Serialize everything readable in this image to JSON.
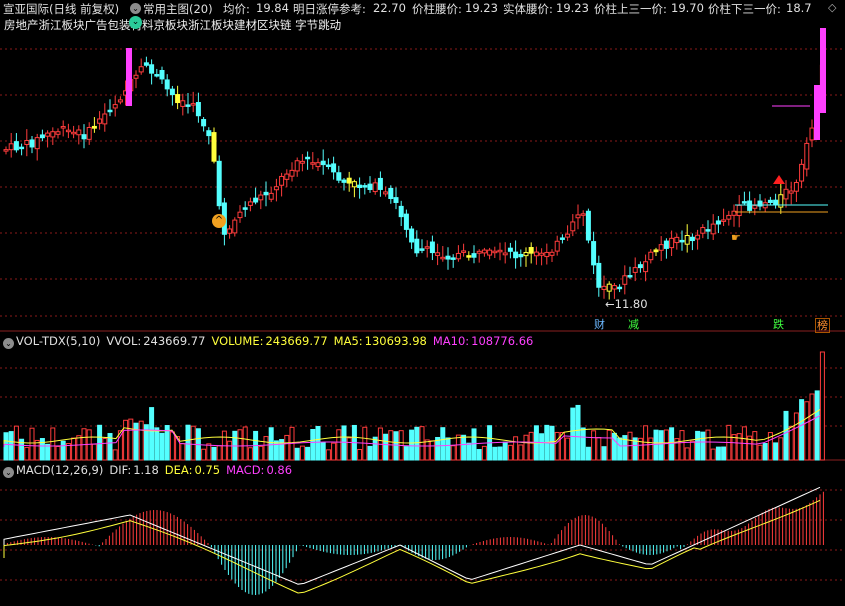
{
  "header": {
    "stock_name": "宣亚国际(日线 前复权)",
    "formula_menu": "常用主图(20)",
    "avg_label": "均价:",
    "avg_value": "19.84",
    "limit_label": "明日涨停参考:",
    "limit_value": "22.70",
    "waist_label": "价柱腰价:",
    "waist_value": "19.23",
    "body_waist_label": "实体腰价:",
    "body_waist_value": "19.23",
    "upper_third_label": "价柱上三一价:",
    "upper_third_value": "19.70",
    "lower_third_label": "价柱下三一价:",
    "lower_third_value": "18.7"
  },
  "sector_tags": "房地产浙江板块广告包装材料京板块浙江板块建材区块链 字节跳动",
  "price_panel": {
    "low_label": "11.80",
    "event_badges": [
      "财",
      "减",
      "跌",
      "榜"
    ]
  },
  "volume_panel": {
    "indicator": "VOL-TDX(5,10)",
    "vvol_label": "VVOL:",
    "vvol_value": "243669.77",
    "volume_label": "VOLUME:",
    "volume_value": "243669.77",
    "ma5_label": "MA5:",
    "ma5_value": "130693.98",
    "ma10_label": "MA10:",
    "ma10_value": "108776.66"
  },
  "macd_panel": {
    "indicator": "MACD(12,26,9)",
    "dif_label": "DIF:",
    "dif_value": "1.18",
    "dea_label": "DEA:",
    "dea_value": "0.75",
    "macd_label": "MACD:",
    "macd_value": "0.86"
  },
  "colors": {
    "up": "#ff3c3c",
    "down": "#54ffff",
    "yellow": "#ffff3c",
    "magenta": "#ff40ff",
    "dashed_grid": "#8a1a1a"
  }
}
